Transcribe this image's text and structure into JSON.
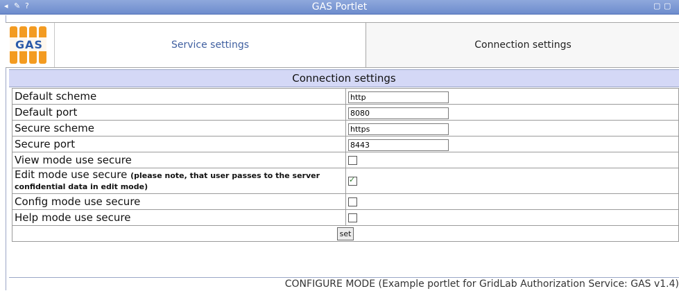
{
  "window": {
    "title": "GAS Portlet",
    "controls_left": [
      "◂",
      "✎",
      "?"
    ],
    "controls_right": [
      "▢",
      "▢"
    ]
  },
  "logo": {
    "text": "GAS"
  },
  "tabs": [
    {
      "label": "Service settings"
    },
    {
      "label": "Connection settings"
    }
  ],
  "section": {
    "title": "Connection settings"
  },
  "settings": {
    "default_scheme": {
      "label": "Default scheme",
      "value": "http"
    },
    "default_port": {
      "label": "Default port",
      "value": "8080"
    },
    "secure_scheme": {
      "label": "Secure scheme",
      "value": "https"
    },
    "secure_port": {
      "label": "Secure port",
      "value": "8443"
    },
    "view_mode_secure": {
      "label": "View mode use secure",
      "checked": false
    },
    "edit_mode_secure": {
      "label": "Edit mode use secure",
      "note": "(please note, that user passes to the server confidential data in edit mode)",
      "checked": true
    },
    "config_mode_secure": {
      "label": "Config mode use secure",
      "checked": false
    },
    "help_mode_secure": {
      "label": "Help mode use secure",
      "checked": false
    }
  },
  "buttons": {
    "set": "set"
  },
  "status": {
    "text": "CONFIGURE MODE (Example portlet for GridLab Authorization Service: GAS v1.4)"
  },
  "colors": {
    "titlebar": "#7b97d3",
    "section_header": "#d4d8f6",
    "tab_active_text": "#3f5fa0",
    "logo_orange": "#f39b21"
  }
}
